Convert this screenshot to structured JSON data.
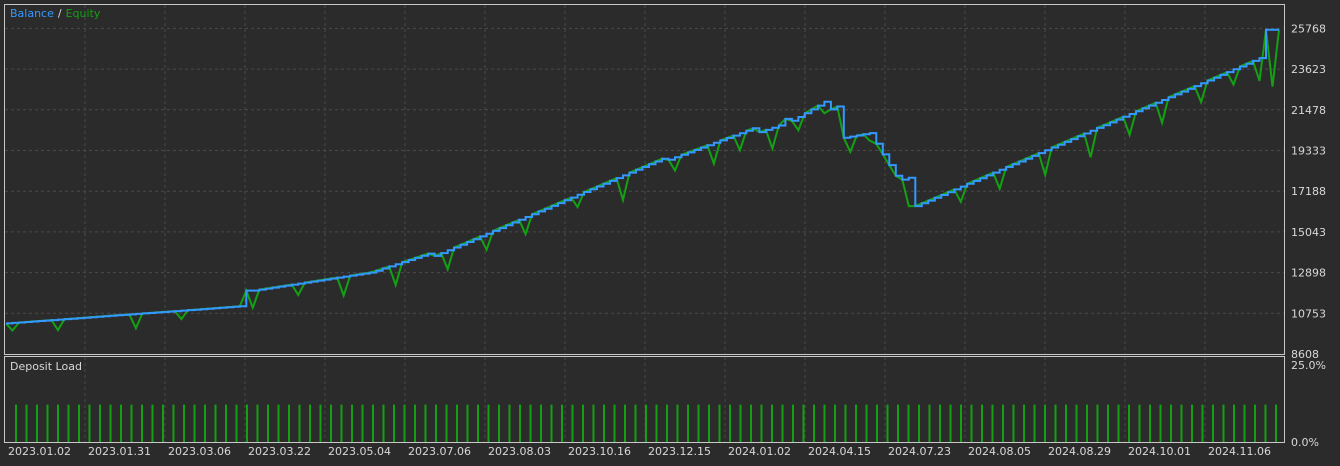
{
  "legend": {
    "balance_label": "Balance",
    "separator": "/",
    "equity_label": "Equity",
    "balance_color": "#3399ff",
    "equity_color": "#13a113"
  },
  "panel2": {
    "title": "Deposit Load",
    "y_top_label": "25.0%",
    "y_bottom_label": "0.0%",
    "bar_color": "#13a113"
  },
  "colors": {
    "background": "#2b2b2b",
    "grid": "#4a4a4a",
    "border": "#c8c8c8",
    "text": "#d8d8d8"
  },
  "chart_data": [
    {
      "type": "line",
      "x_ticks": [
        "2023.01.02",
        "2023.01.31",
        "2023.03.06",
        "2023.03.22",
        "2023.05.04",
        "2023.07.06",
        "2023.08.03",
        "2023.10.16",
        "2023.12.15",
        "2024.01.02",
        "2024.04.15",
        "2024.07.23",
        "2024.08.05",
        "2024.08.29",
        "2024.10.01",
        "2024.11.06"
      ],
      "y_ticks": [
        8608,
        10753,
        12898,
        15043,
        17188,
        19333,
        21478,
        23623,
        25768
      ],
      "ylim": [
        8608,
        27000
      ],
      "grid": true,
      "legend_position": "top-left",
      "balance_anchors": [
        [
          0,
          10220
        ],
        [
          36,
          11120
        ],
        [
          37,
          11950
        ],
        [
          38,
          11950
        ],
        [
          56,
          12900
        ],
        [
          57,
          13000
        ],
        [
          65,
          13900
        ],
        [
          66,
          13780
        ],
        [
          101,
          18900
        ],
        [
          102,
          18850
        ],
        [
          115,
          20500
        ],
        [
          116,
          20300
        ],
        [
          119,
          20650
        ],
        [
          120,
          21000
        ],
        [
          121,
          20900
        ],
        [
          126,
          21900
        ],
        [
          127,
          21500
        ],
        [
          128,
          21650
        ],
        [
          129,
          20000
        ],
        [
          133,
          20250
        ],
        [
          137,
          18000
        ],
        [
          138,
          17800
        ],
        [
          139,
          17900
        ],
        [
          140,
          16400
        ],
        [
          193,
          24200
        ],
        [
          194,
          25700
        ],
        [
          196,
          25700
        ]
      ],
      "equity_dips": [
        [
          1,
          -400
        ],
        [
          8,
          -550
        ],
        [
          20,
          -750
        ],
        [
          27,
          -450
        ],
        [
          38,
          -900
        ],
        [
          45,
          -600
        ],
        [
          52,
          -1000
        ],
        [
          60,
          -1100
        ],
        [
          68,
          -1000
        ],
        [
          74,
          -850
        ],
        [
          80,
          -900
        ],
        [
          88,
          -650
        ],
        [
          95,
          -1300
        ],
        [
          103,
          -700
        ],
        [
          109,
          -1100
        ],
        [
          113,
          -900
        ],
        [
          118,
          -1100
        ],
        [
          122,
          -700
        ],
        [
          126,
          -600
        ],
        [
          130,
          -800
        ],
        [
          133,
          -400
        ],
        [
          139,
          -1500
        ],
        [
          147,
          -800
        ],
        [
          153,
          -1000
        ],
        [
          160,
          -1300
        ],
        [
          167,
          -1400
        ],
        [
          173,
          -1100
        ],
        [
          178,
          -1200
        ],
        [
          184,
          -1000
        ],
        [
          189,
          -800
        ],
        [
          193,
          -1200
        ],
        [
          195,
          -3000
        ]
      ],
      "num_points": 197
    },
    {
      "type": "bar",
      "title": "Deposit Load",
      "ylim": [
        0,
        25
      ],
      "bar_value_percent": 11
    }
  ]
}
